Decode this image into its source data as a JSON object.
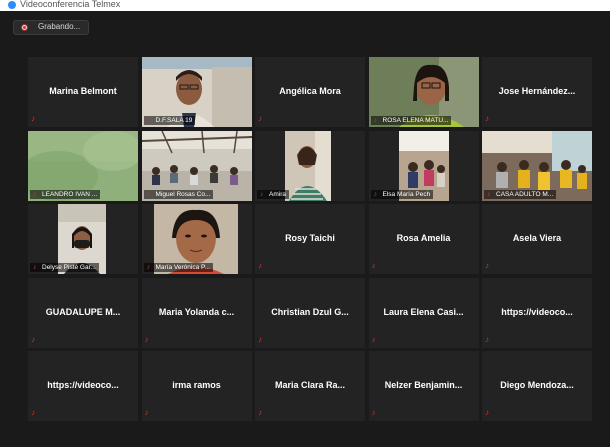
{
  "window": {
    "title": "Videoconferencia Telmex",
    "recording_label": "Grabando..."
  },
  "colors": {
    "background": "#1a1a1a",
    "tile": "#232323",
    "active_speaker": "#c8d24a",
    "muted_icon": "#e0332f"
  },
  "icons": {
    "muted": "microphone-muted-icon",
    "recording": "record-dot-icon"
  },
  "participants": [
    {
      "name": "Marina Belmont",
      "video": false
    },
    {
      "name": "D.F.SALA 19",
      "video": true,
      "scene": "woman-glasses"
    },
    {
      "name": "Angélica Mora",
      "video": false
    },
    {
      "name": "ROSA ELENA MATU...",
      "video": true,
      "scene": "woman-speaking",
      "active": true
    },
    {
      "name": "Jose Hernández...",
      "video": false
    },
    {
      "name": "LEANDRO IVAN ...",
      "video": true,
      "scene": "blurred-green"
    },
    {
      "name": "Miguel Rosas Co...",
      "video": true,
      "scene": "group-room"
    },
    {
      "name": "Amira",
      "video": true,
      "scene": "woman-striped"
    },
    {
      "name": "Elsa María Pech",
      "video": true,
      "scene": "group-small"
    },
    {
      "name": "CASA ADULTO M...",
      "video": true,
      "scene": "group-yellow"
    },
    {
      "name": "Delyse Pisté Gar...",
      "video": true,
      "scene": "woman-mask"
    },
    {
      "name": "María Verónica P...",
      "video": true,
      "scene": "woman-closeup"
    },
    {
      "name": "Rosy Taichi",
      "video": false
    },
    {
      "name": "Rosa Amelia",
      "video": false
    },
    {
      "name": "Asela Viera",
      "video": false
    },
    {
      "name": "GUADALUPE M...",
      "video": false
    },
    {
      "name": "Maria Yolanda c...",
      "video": false
    },
    {
      "name": "Christian Dzul G...",
      "video": false
    },
    {
      "name": "Laura Elena Casi...",
      "video": false
    },
    {
      "name": "https://videoco...",
      "video": false
    },
    {
      "name": "https://videoco...",
      "video": false
    },
    {
      "name": "irma ramos",
      "video": false
    },
    {
      "name": "Maria Clara Ra...",
      "video": false
    },
    {
      "name": "Nelzer Benjamin...",
      "video": false
    },
    {
      "name": "Diego Mendoza...",
      "video": false
    }
  ]
}
